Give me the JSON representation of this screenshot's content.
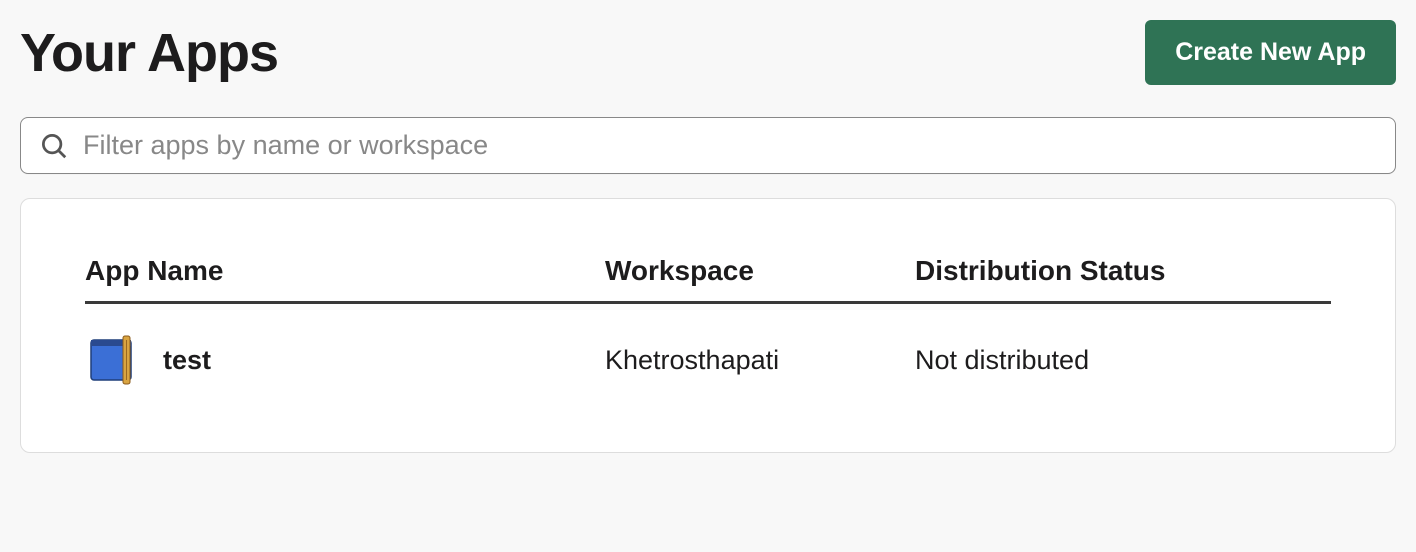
{
  "header": {
    "title": "Your Apps",
    "create_button_label": "Create New App"
  },
  "search": {
    "placeholder": "Filter apps by name or workspace",
    "value": ""
  },
  "table": {
    "columns": {
      "name": "App Name",
      "workspace": "Workspace",
      "status": "Distribution Status"
    },
    "rows": [
      {
        "icon": "app-default-icon",
        "name": "test",
        "workspace": "Khetrosthapati",
        "status": "Not distributed"
      }
    ]
  }
}
